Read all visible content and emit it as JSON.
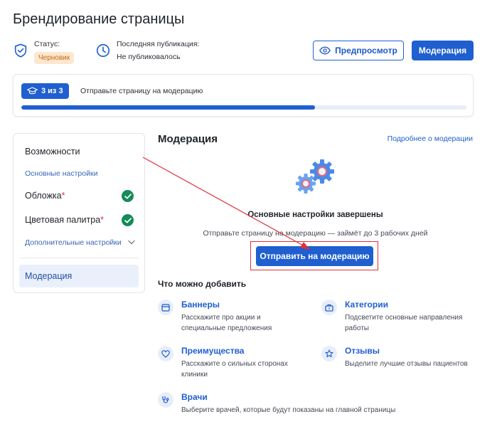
{
  "page": {
    "title": "Брендирование страницы"
  },
  "status": {
    "label": "Статус:",
    "badge": "Черновик"
  },
  "publication": {
    "label": "Последняя публикация:",
    "value": "Не публиковалось"
  },
  "header_buttons": {
    "preview": "Предпросмотр",
    "moderation": "Модерация"
  },
  "progress": {
    "step_badge": "3 из 3",
    "text": "Отправьте страницу на модерацию",
    "fraction": 0.66
  },
  "sidebar": {
    "item_features": "Возможности",
    "section_basic": "Основные настройки",
    "item_cover": "Обложка",
    "item_palette": "Цветовая палитра",
    "required_mark": "*",
    "section_additional": "Дополнительные настройки",
    "item_moderation": "Модерация"
  },
  "main": {
    "title": "Модерация",
    "more_link": "Подробнее о модерации",
    "done_title": "Основные настройки завершены",
    "done_sub": "Отправьте страницу на модерацию — займёт до 3 рабочих дней",
    "submit": "Отправить на модерацию"
  },
  "add_section": {
    "title": "Что можно добавить",
    "items": [
      {
        "title": "Баннеры",
        "desc": "Расскажите про акции и специальные предложения",
        "icon": "banner-icon"
      },
      {
        "title": "Категории",
        "desc": "Подсветите основные направления работы",
        "icon": "briefcase-icon"
      },
      {
        "title": "Преимущества",
        "desc": "Расскажите о сильных сторонах клиники",
        "icon": "heart-icon"
      },
      {
        "title": "Отзывы",
        "desc": "Выделите лучшие отзывы пациентов",
        "icon": "star-icon"
      },
      {
        "title": "Врачи",
        "desc": "Выберите врачей, которые будут показаны на главной страницы",
        "icon": "stethoscope-icon"
      }
    ]
  },
  "colors": {
    "accent": "#1f5fd0",
    "success": "#158a5a",
    "draft": "#c66a14",
    "annotation": "#e0303a"
  }
}
